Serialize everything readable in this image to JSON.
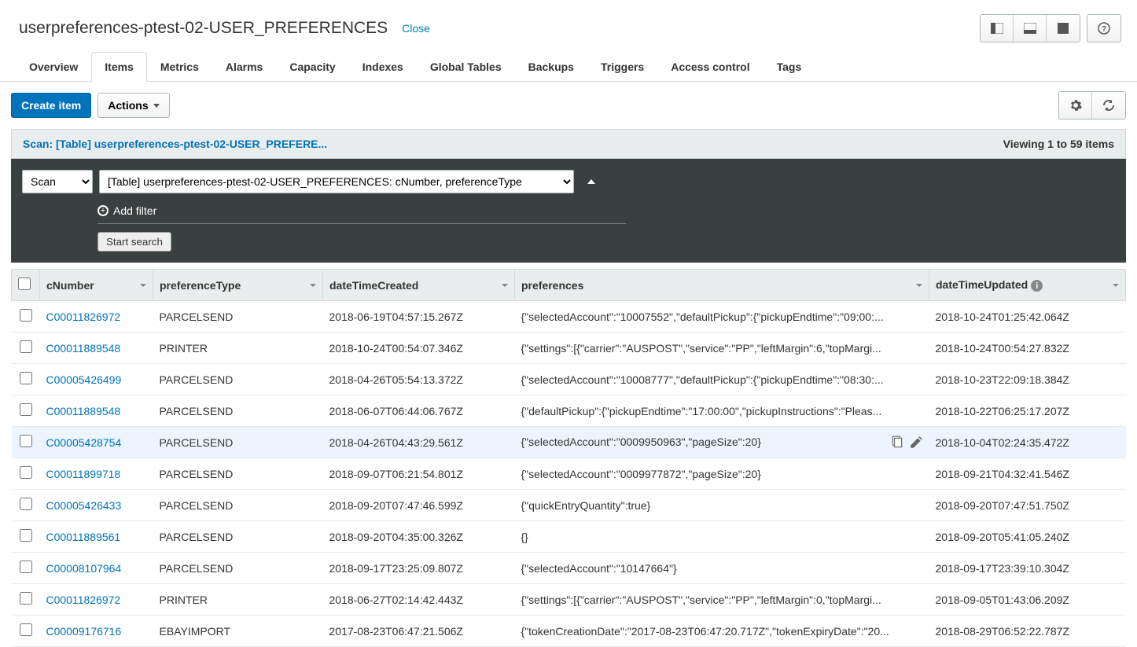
{
  "header": {
    "title": "userpreferences-ptest-02-USER_PREFERENCES",
    "close": "Close"
  },
  "tabs": {
    "list": [
      "Overview",
      "Items",
      "Metrics",
      "Alarms",
      "Capacity",
      "Indexes",
      "Global Tables",
      "Backups",
      "Triggers",
      "Access control",
      "Tags"
    ],
    "active": 1
  },
  "toolbar": {
    "create": "Create item",
    "actions": "Actions"
  },
  "scanBar": {
    "label": "Scan: [Table] userpreferences-ptest-02-USER_PREFERE...",
    "viewing": "Viewing 1 to 59 items"
  },
  "darkbox": {
    "mode": "Scan",
    "target": "[Table] userpreferences-ptest-02-USER_PREFERENCES: cNumber, preferenceType",
    "addFilter": "Add filter",
    "startSearch": "Start search"
  },
  "columns": {
    "cNumber": "cNumber",
    "preferenceType": "preferenceType",
    "dateTimeCreated": "dateTimeCreated",
    "preferences": "preferences",
    "dateTimeUpdated": "dateTimeUpdated"
  },
  "rows": [
    {
      "cNumber": "C00011826972",
      "preferenceType": "PARCELSEND",
      "dateTimeCreated": "2018-06-19T04:57:15.267Z",
      "preferences": "{\"selectedAccount\":\"10007552\",\"defaultPickup\":{\"pickupEndtime\":\"09:00:...",
      "dateTimeUpdated": "2018-10-24T01:25:42.064Z"
    },
    {
      "cNumber": "C00011889548",
      "preferenceType": "PRINTER",
      "dateTimeCreated": "2018-10-24T00:54:07.346Z",
      "preferences": "{\"settings\":[{\"carrier\":\"AUSPOST\",\"service\":\"PP\",\"leftMargin\":6,\"topMargi...",
      "dateTimeUpdated": "2018-10-24T00:54:27.832Z"
    },
    {
      "cNumber": "C00005426499",
      "preferenceType": "PARCELSEND",
      "dateTimeCreated": "2018-04-26T05:54:13.372Z",
      "preferences": "{\"selectedAccount\":\"10008777\",\"defaultPickup\":{\"pickupEndtime\":\"08:30:...",
      "dateTimeUpdated": "2018-10-23T22:09:18.384Z"
    },
    {
      "cNumber": "C00011889548",
      "preferenceType": "PARCELSEND",
      "dateTimeCreated": "2018-06-07T06:44:06.767Z",
      "preferences": "{\"defaultPickup\":{\"pickupEndtime\":\"17:00:00\",\"pickupInstructions\":\"Pleas...",
      "dateTimeUpdated": "2018-10-22T06:25:17.207Z"
    },
    {
      "cNumber": "C00005428754",
      "preferenceType": "PARCELSEND",
      "dateTimeCreated": "2018-04-26T04:43:29.561Z",
      "preferences": "{\"selectedAccount\":\"0009950963\",\"pageSize\":20}",
      "dateTimeUpdated": "2018-10-04T02:24:35.472Z",
      "highlight": true,
      "showIcons": true
    },
    {
      "cNumber": "C00011899718",
      "preferenceType": "PARCELSEND",
      "dateTimeCreated": "2018-09-07T06:21:54.801Z",
      "preferences": "{\"selectedAccount\":\"0009977872\",\"pageSize\":20}",
      "dateTimeUpdated": "2018-09-21T04:32:41.546Z"
    },
    {
      "cNumber": "C00005426433",
      "preferenceType": "PARCELSEND",
      "dateTimeCreated": "2018-09-20T07:47:46.599Z",
      "preferences": "{\"quickEntryQuantity\":true}",
      "dateTimeUpdated": "2018-09-20T07:47:51.750Z"
    },
    {
      "cNumber": "C00011889561",
      "preferenceType": "PARCELSEND",
      "dateTimeCreated": "2018-09-20T04:35:00.326Z",
      "preferences": "{}",
      "dateTimeUpdated": "2018-09-20T05:41:05.240Z"
    },
    {
      "cNumber": "C00008107964",
      "preferenceType": "PARCELSEND",
      "dateTimeCreated": "2018-09-17T23:25:09.807Z",
      "preferences": "{\"selectedAccount\":\"10147664\"}",
      "dateTimeUpdated": "2018-09-17T23:39:10.304Z"
    },
    {
      "cNumber": "C00011826972",
      "preferenceType": "PRINTER",
      "dateTimeCreated": "2018-06-27T02:14:42.443Z",
      "preferences": "{\"settings\":[{\"carrier\":\"AUSPOST\",\"service\":\"PP\",\"leftMargin\":0,\"topMargi...",
      "dateTimeUpdated": "2018-09-05T01:43:06.209Z"
    },
    {
      "cNumber": "C00009176716",
      "preferenceType": "EBAYIMPORT",
      "dateTimeCreated": "2017-08-23T06:47:21.506Z",
      "preferences": "{\"tokenCreationDate\":\"2017-08-23T06:47:20.717Z\",\"tokenExpiryDate\":\"20...",
      "dateTimeUpdated": "2018-08-29T06:52:22.787Z"
    }
  ]
}
